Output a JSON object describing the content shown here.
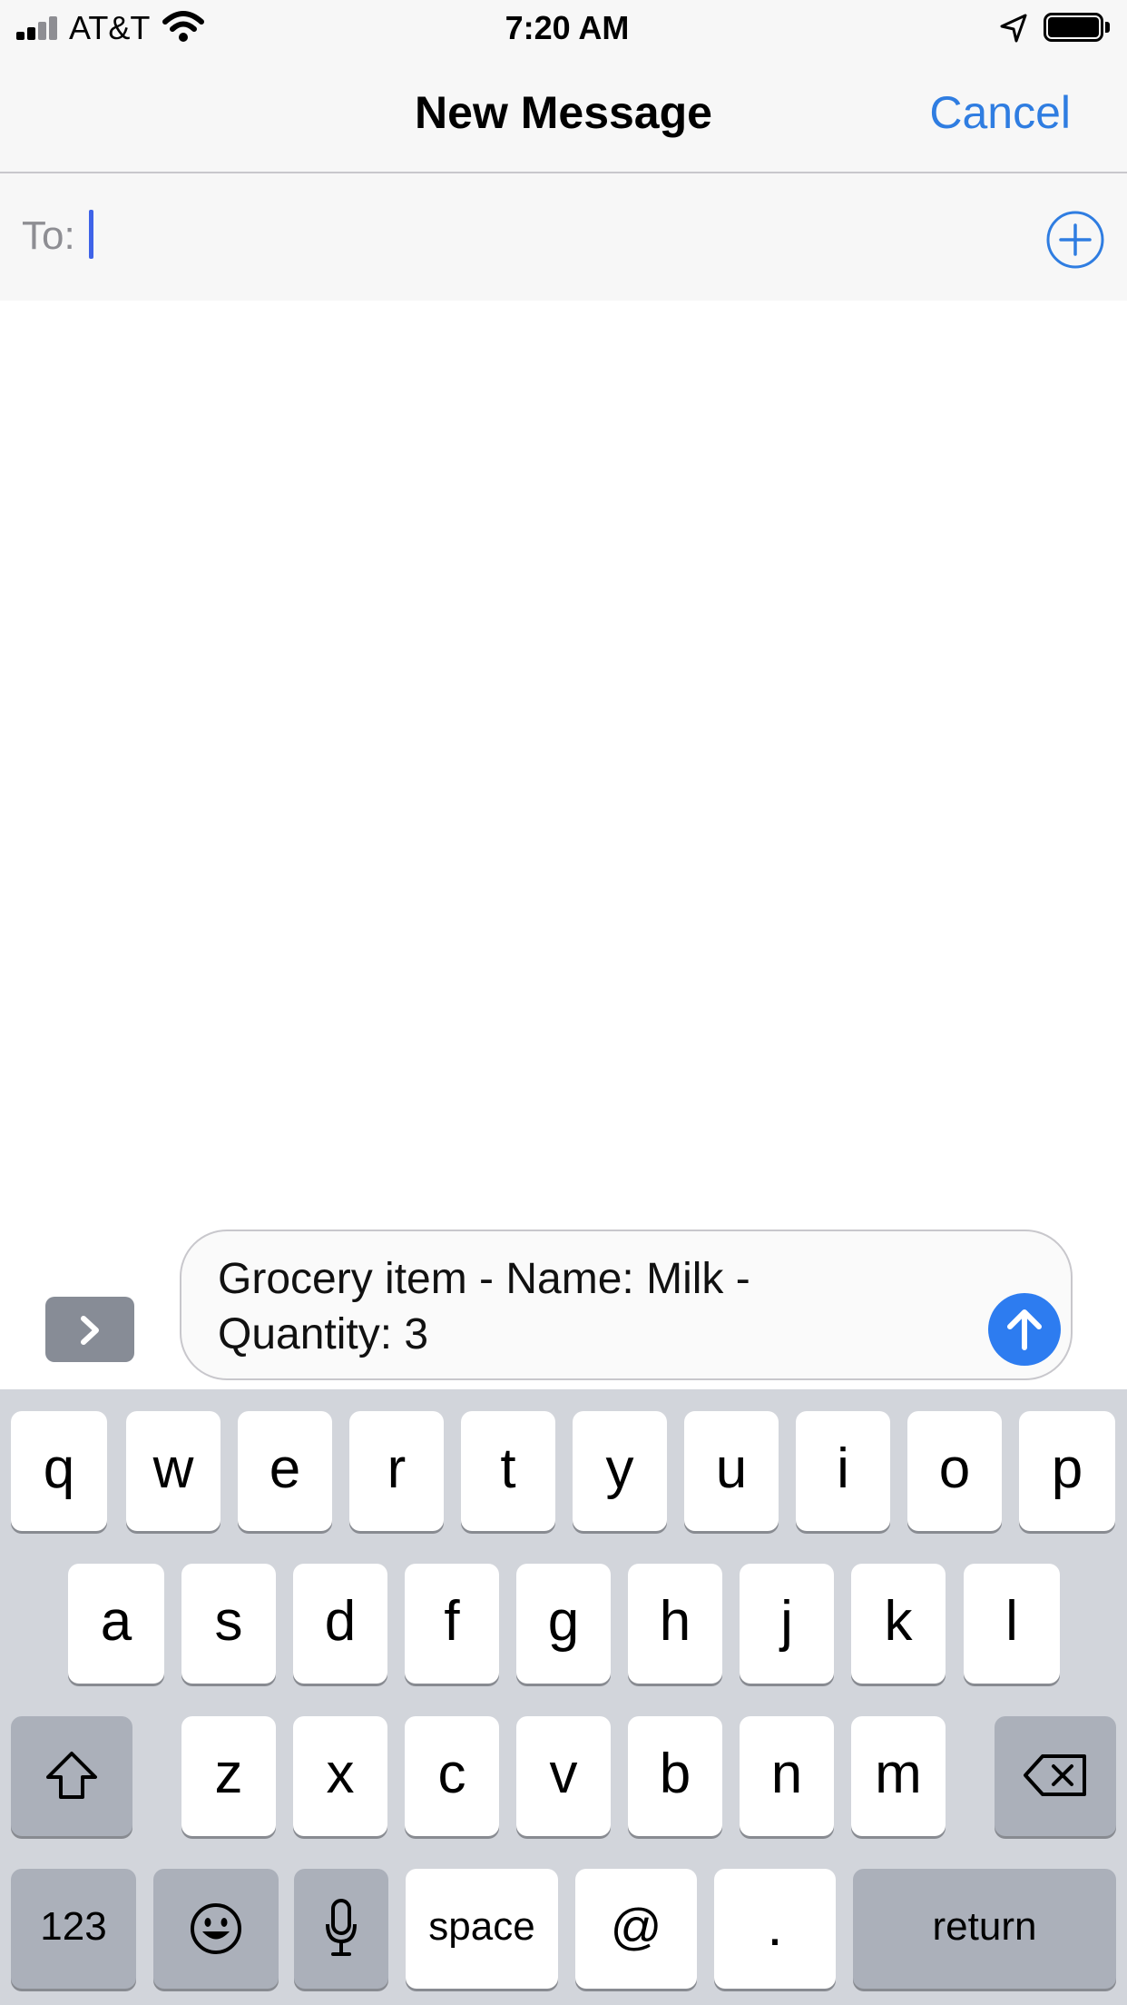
{
  "status_bar": {
    "carrier": "AT&T",
    "time": "7:20 AM",
    "icons": [
      "signal-icon",
      "wifi-icon",
      "location-arrow-icon",
      "battery-icon"
    ]
  },
  "nav": {
    "title": "New Message",
    "cancel_label": "Cancel"
  },
  "recipient": {
    "label": "To:",
    "value": "",
    "add_icon": "plus-circle-icon"
  },
  "compose": {
    "apps_icon": "chevron-right-icon",
    "message_text": "Grocery item - Name: Milk -\nQuantity: 3",
    "send_icon": "arrow-up-icon"
  },
  "keyboard": {
    "row1": [
      "q",
      "w",
      "e",
      "r",
      "t",
      "y",
      "u",
      "i",
      "o",
      "p"
    ],
    "row2": [
      "a",
      "s",
      "d",
      "f",
      "g",
      "h",
      "j",
      "k",
      "l"
    ],
    "row3": [
      "z",
      "x",
      "c",
      "v",
      "b",
      "n",
      "m"
    ],
    "numbers_label": "123",
    "space_label": "space",
    "at_label": "@",
    "period_label": ".",
    "return_label": "return",
    "special_icons": [
      "shift-icon",
      "delete-icon",
      "emoji-icon",
      "microphone-icon"
    ]
  },
  "colors": {
    "accent": "#2f7de1",
    "send_button": "#2d7cf0",
    "caret": "#3f63e8",
    "keyboard_bg": "#d2d5db",
    "dark_key": "#abb0ba"
  }
}
